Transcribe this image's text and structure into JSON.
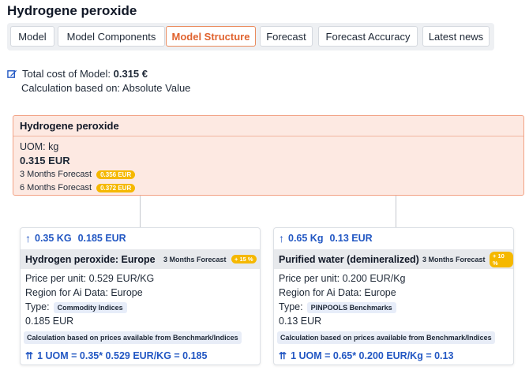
{
  "page": {
    "title": "Hydrogene peroxide"
  },
  "tabs": [
    {
      "label": "Model",
      "active": false
    },
    {
      "label": "Model Components",
      "active": false
    },
    {
      "label": "Model Structure",
      "active": true
    },
    {
      "label": "Forecast",
      "active": false
    },
    {
      "label": "Forecast Accuracy",
      "active": false
    },
    {
      "label": "Latest news",
      "active": false
    }
  ],
  "summary": {
    "cost_label": "Total cost of Model:",
    "cost_value": "0.315 €",
    "calc_label": "Calculation based on: Absolute Value"
  },
  "root": {
    "title": "Hydrogene peroxide",
    "uom": "UOM: kg",
    "price": "0.315 EUR",
    "forecast3_label": "3 Months Forecast",
    "forecast3_value": "0.356 EUR",
    "forecast6_label": "6 Months Forecast",
    "forecast6_value": "0.372 EUR"
  },
  "children": [
    {
      "qty": "0.35 KG",
      "cost": "0.185 EUR",
      "name": "Hydrogen peroxide: Europe",
      "forecast_label": "3 Months Forecast",
      "forecast_pct": "+ 15 %",
      "price_per_unit": "Price per unit: 0.529 EUR/KG",
      "region": "Region for Ai Data: Europe",
      "type_label": "Type:",
      "type_value": "Commodity Indices",
      "value": "0.185 EUR",
      "note": "Calculation based on prices available from Benchmark/Indices",
      "formula": "1 UOM = 0.35* 0.529 EUR/KG = 0.185"
    },
    {
      "qty": "0.65 Kg",
      "cost": "0.13 EUR",
      "name": "Purified water (demineralized)",
      "forecast_label": "3 Months Forecast",
      "forecast_pct": "+ 10 %",
      "price_per_unit": "Price per unit: 0.200 EUR/Kg",
      "region": "Region for Ai Data: Europe",
      "type_label": "Type:",
      "type_value": "PINPOOLS Benchmarks",
      "value": "0.13 EUR",
      "note": "Calculation based on prices available from Benchmark/Indices",
      "formula": "1 UOM = 0.65* 0.200 EUR/Kg = 0.13"
    }
  ],
  "colors": {
    "accent": "#e0632f",
    "link_blue": "#2257c3",
    "badge_yellow": "#f5b800",
    "root_bg": "#fde9e2"
  },
  "icons": {
    "edit": "edit-icon",
    "arrow": "arrow-up-icon",
    "formula": "double-arrow-up-icon"
  }
}
